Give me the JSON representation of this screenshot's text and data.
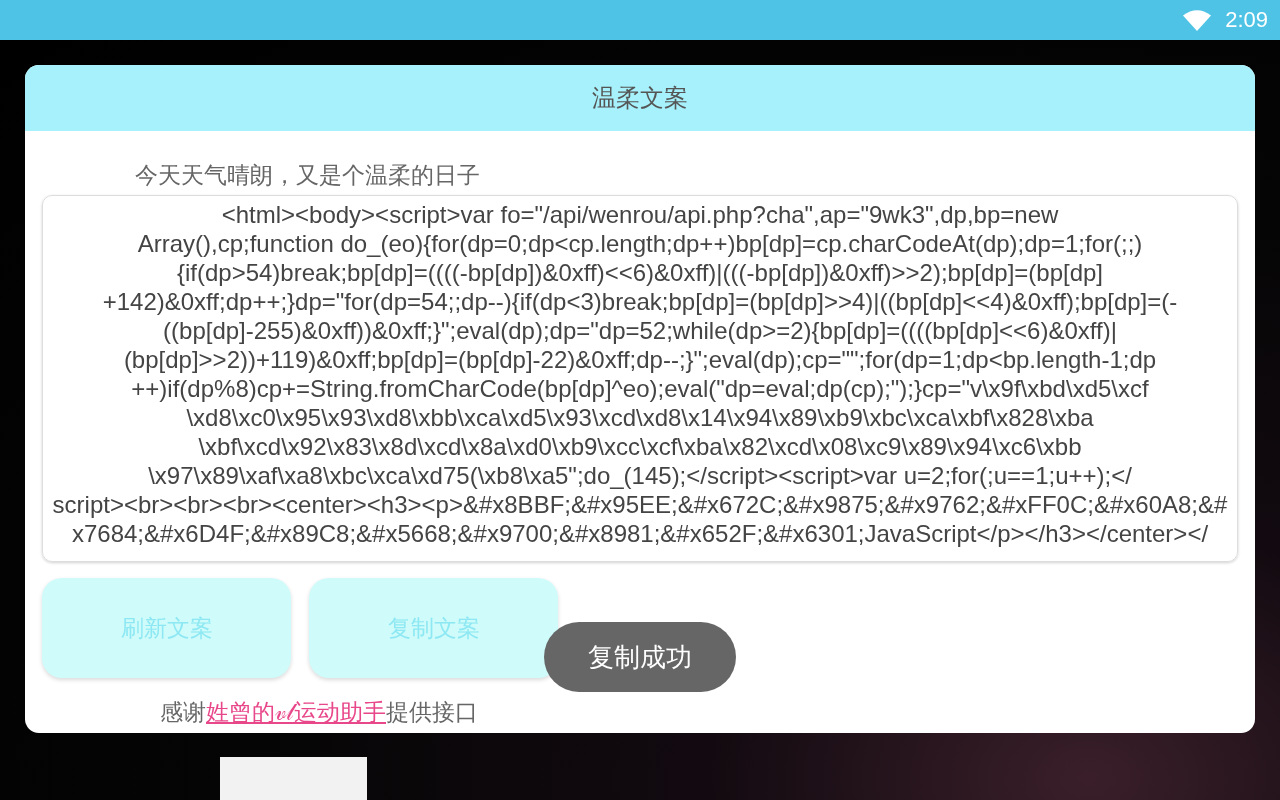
{
  "status_bar": {
    "time": "2:09"
  },
  "dialog": {
    "title": "温柔文案",
    "subtitle": "今天天气晴朗，又是个温柔的日子",
    "text_field": {
      "value": "<html><body><script>var fo=\"/api/wenrou/api.php?cha\",ap=\"9wk3\",dp,bp=new\nArray(),cp;function do_(eo){for(dp=0;dp<cp.length;dp++)bp[dp]=cp.charCodeAt(dp);dp=1;for(;;)\n{if(dp>54)break;bp[dp]=((((-bp[dp])&0xff)<<6)&0xff)|(((-bp[dp])&0xff)>>2);bp[dp]=(bp[dp]\n+142)&0xff;dp++;}dp=\"for(dp=54;;dp--){if(dp<3)break;bp[dp]=(bp[dp]>>4)|((bp[dp]<<4)&0xff);bp[dp]=(-\n((bp[dp]-255)&0xff))&0xff;}\";eval(dp);dp=\"dp=52;while(dp>=2){bp[dp]=((((bp[dp]<<6)&0xff)|\n(bp[dp]>>2))+119)&0xff;bp[dp]=(bp[dp]-22)&0xff;dp--;}\";eval(dp);cp=\"\";for(dp=1;dp<bp.length-1;dp\n++)if(dp%8)cp+=String.fromCharCode(bp[dp]^eo);eval(\"dp=eval;dp(cp);\");}cp=\"v\\x9f\\xbd\\xd5\\xcf\n\\xd8\\xc0\\x95\\x93\\xd8\\xbb\\xca\\xd5\\x93\\xcd\\xd8\\x14\\x94\\x89\\xb9\\xbc\\xca\\xbf\\x828\\xba\n\\xbf\\xcd\\x92\\x83\\x8d\\xcd\\x8a\\xd0\\xb9\\xcc\\xcf\\xba\\x82\\xcd\\x08\\xc9\\x89\\x94\\xc6\\xbb\n\\x97\\x89\\xaf\\xa8\\xbc\\xca\\xd75(\\xb8\\xa5\";do_(145);</script><script>var u=2;for(;u==1;u++);</\nscript><br><br><br><center><h3><p>&#x8BBF;&#x95EE;&#x672C;&#x9875;&#x9762;&#xFF0C;&#x60A8;&#\nx7684;&#x6D4F;&#x89C8;&#x5668;&#x9700;&#x8981;&#x652F;&#x6301;JavaScript</p></h3></center></"
    },
    "buttons": [
      {
        "label": "刷新文案"
      },
      {
        "label": "复制文案"
      }
    ],
    "credit": {
      "before": "感谢",
      "link": "姓曾的𝓋𝓁运动助手",
      "after": "提供接口"
    }
  },
  "toast": {
    "text": "复制成功"
  }
}
